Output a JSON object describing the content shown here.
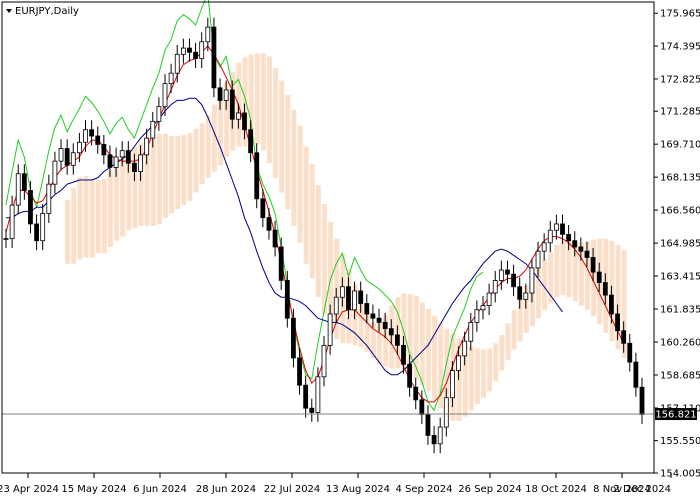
{
  "chart_data": {
    "type": "candlestick",
    "title": "EURJPY,Daily",
    "y_axis": {
      "ylim": [
        154.005,
        176.5
      ],
      "tick_labels": [
        "175.965",
        "174.395",
        "172.825",
        "171.285",
        "169.710",
        "168.135",
        "166.560",
        "164.985",
        "163.415",
        "161.835",
        "160.260",
        "158.685",
        "157.110",
        "155.550",
        "154.005"
      ],
      "position": "right"
    },
    "x_axis": {
      "tick_labels": [
        "23 Apr 2024",
        "15 May 2024",
        "6 Jun 2024",
        "28 Jun 2024",
        "22 Jul 2024",
        "13 Aug 2024",
        "4 Sep 2024",
        "26 Sep 2024",
        "18 Oct 2024",
        "8 Nov 2024",
        "2 Dec 2024"
      ]
    },
    "current_price": "156.821",
    "current_price_value": 156.821,
    "grid": false,
    "colors": {
      "candle": "#000000",
      "tenkan": "#dd0000",
      "kijun": "#00008b",
      "chikou": "#22cc22",
      "kumo_bull": "#f4a460",
      "kumo_bear": "#b8a7c8",
      "price_line": "#808080",
      "tag_bg": "#000000"
    },
    "series": [
      {
        "kind": "close",
        "values": [
          165.2,
          166.8,
          168.3,
          167.5,
          165.9,
          165.1,
          166.4,
          167.8,
          168.9,
          169.5,
          168.7,
          169.3,
          169.8,
          170.4,
          170.1,
          169.7,
          169.2,
          168.6,
          169.1,
          169.4,
          168.8,
          168.4,
          169.2,
          170.0,
          170.8,
          171.5,
          172.6,
          173.1,
          174.0,
          174.3,
          174.1,
          173.8,
          174.6,
          175.3,
          172.4,
          171.8,
          172.3,
          170.9,
          171.2,
          170.4,
          169.3,
          167.1,
          166.2,
          165.6,
          164.8,
          163.2,
          161.4,
          159.5,
          158.2,
          157.1,
          156.9,
          158.6,
          160.1,
          161.6,
          162.4,
          162.9,
          161.8,
          162.7,
          162.1,
          161.6,
          161.4,
          161.2,
          160.9,
          160.6,
          160.1,
          159.2,
          158.1,
          157.5,
          156.8,
          155.8,
          155.4,
          156.2,
          157.6,
          158.9,
          159.6,
          160.3,
          161.2,
          161.8,
          162.0,
          162.6,
          163.2,
          163.7,
          163.5,
          162.9,
          162.3,
          162.6,
          163.8,
          164.6,
          165.0,
          165.6,
          165.9,
          165.4,
          165.1,
          164.8,
          164.6,
          164.3,
          163.6,
          163.1,
          162.5,
          161.6,
          160.8,
          160.2,
          159.3,
          158.1,
          156.8
        ]
      },
      {
        "kind": "tenkan",
        "values": [
          165.5,
          166.6,
          167.5,
          167.5,
          167.2,
          166.9,
          167.0,
          167.5,
          168.1,
          168.5,
          168.7,
          168.9,
          169.1,
          169.6,
          169.9,
          169.9,
          169.6,
          169.2,
          169.0,
          168.9,
          168.9,
          168.9,
          169.0,
          169.5,
          170.2,
          170.9,
          171.6,
          172.3,
          173.0,
          173.5,
          173.7,
          173.8,
          174.1,
          174.4,
          174.0,
          173.5,
          172.9,
          172.3,
          171.6,
          170.6,
          169.6,
          168.5,
          167.5,
          166.5,
          165.4,
          164.1,
          162.7,
          161.3,
          160.0,
          158.9,
          158.3,
          158.6,
          159.4,
          160.4,
          161.2,
          161.7,
          161.8,
          161.8,
          161.5,
          161.2,
          160.9,
          160.7,
          160.5,
          160.2,
          159.7,
          159.1,
          158.5,
          158.0,
          157.6,
          157.4,
          157.4,
          157.7,
          158.3,
          159.1,
          159.9,
          160.6,
          161.2,
          161.6,
          162.0,
          162.4,
          162.8,
          163.1,
          163.3,
          163.3,
          163.4,
          163.7,
          164.2,
          164.7,
          165.1,
          165.3,
          165.3,
          165.2,
          165.0,
          164.7,
          164.3,
          163.8,
          163.2,
          162.6,
          162.0,
          161.4,
          160.8,
          160.2
        ]
      },
      {
        "kind": "kijun",
        "values": [
          166.2,
          166.2,
          166.4,
          166.5,
          166.5,
          166.7,
          166.7,
          167.0,
          167.3,
          167.5,
          167.8,
          167.9,
          168.0,
          168.0,
          168.0,
          168.1,
          168.4,
          168.6,
          168.8,
          169.0,
          169.2,
          169.6,
          170.0,
          170.3,
          170.6,
          170.9,
          171.3,
          171.6,
          171.8,
          171.8,
          171.9,
          171.9,
          171.6,
          171.0,
          170.3,
          169.6,
          168.8,
          168.0,
          167.2,
          166.2,
          165.5,
          164.6,
          163.8,
          163.1,
          162.6,
          162.4,
          162.4,
          162.3,
          162.2,
          162.0,
          161.7,
          161.4,
          161.3,
          161.2,
          161.2,
          161.1,
          160.9,
          160.7,
          160.4,
          160.1,
          159.7,
          159.3,
          158.9,
          158.7,
          158.7,
          158.9,
          159.2,
          159.5,
          159.8,
          160.1,
          160.6,
          161.1,
          161.6,
          162.1,
          162.5,
          162.9,
          163.2,
          163.6,
          164.0,
          164.3,
          164.6,
          164.7,
          164.6,
          164.4,
          164.2,
          164.0,
          163.7,
          163.3,
          162.9,
          162.5,
          162.1,
          161.7
        ]
      }
    ]
  }
}
